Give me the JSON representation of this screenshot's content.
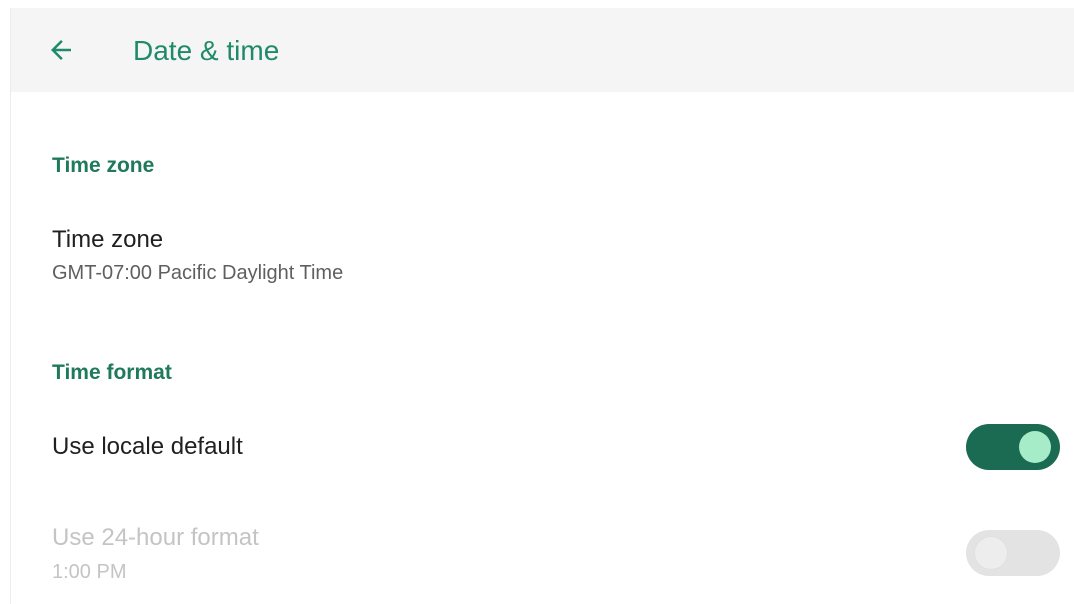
{
  "appbar": {
    "title": "Date & time"
  },
  "sections": {
    "time_zone": {
      "header": "Time zone",
      "item": {
        "title": "Time zone",
        "summary": "GMT-07:00 Pacific Daylight Time"
      }
    },
    "time_format": {
      "header": "Time format",
      "use_locale_default": {
        "title": "Use locale default",
        "checked": true
      },
      "use_24_hour": {
        "title": "Use 24-hour format",
        "summary": "1:00 PM",
        "checked": false,
        "enabled": false
      }
    }
  },
  "colors": {
    "accent": "#1f8a6a",
    "switch_on_track": "#1a6b52",
    "switch_on_thumb": "#a7ecc8",
    "appbar_bg": "#f5f5f5"
  },
  "icons": {
    "back": "arrow-left-icon"
  }
}
